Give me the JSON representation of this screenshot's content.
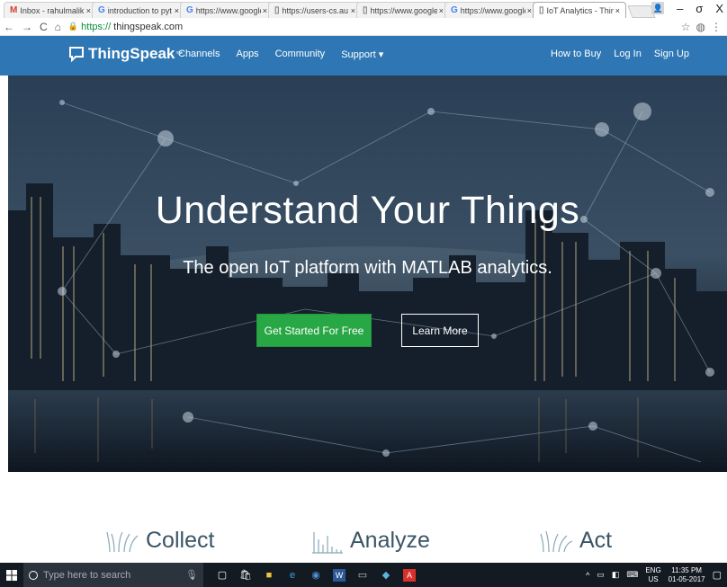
{
  "browser": {
    "tabs": [
      {
        "favicon": "M",
        "favicon_color": "#d23f31",
        "title": "Inbox - rahulmalikll",
        "active": false
      },
      {
        "favicon": "G",
        "favicon_color": "#4285f4",
        "title": "introduction to pyt",
        "active": false
      },
      {
        "favicon": "G",
        "favicon_color": "#4285f4",
        "title": "https://www.google",
        "active": false
      },
      {
        "favicon": "▯",
        "favicon_color": "#777777",
        "title": "https://users-cs.au",
        "active": false
      },
      {
        "favicon": "▯",
        "favicon_color": "#777777",
        "title": "https://www.google",
        "active": false
      },
      {
        "favicon": "G",
        "favicon_color": "#4285f4",
        "title": "https://www.google",
        "active": false
      },
      {
        "favicon": "▯",
        "favicon_color": "#777777",
        "title": "IoT Analytics - Thin",
        "active": true
      }
    ],
    "window_controls": {
      "minimize": "–",
      "maximize": "σ",
      "close": "X"
    },
    "address": {
      "protocol": "https://",
      "host": "thingspeak.com"
    }
  },
  "site": {
    "logo_text": "ThingSpeak",
    "logo_tm": "™",
    "nav_left": [
      "Channels",
      "Apps",
      "Community",
      "Support ▾"
    ],
    "nav_right": [
      "How to Buy",
      "Log In",
      "Sign Up"
    ],
    "brand_color": "#2f77b4"
  },
  "hero": {
    "title": "Understand Your Things",
    "subtitle": "The open IoT platform with MATLAB analytics.",
    "primary_button": "Get Started For Free",
    "secondary_button": "Learn More",
    "primary_color": "#28a745"
  },
  "features": [
    {
      "icon": "collect-icon",
      "label": "Collect"
    },
    {
      "icon": "analyze-icon",
      "label": "Analyze"
    },
    {
      "icon": "act-icon",
      "label": "Act"
    }
  ],
  "taskbar": {
    "search_placeholder": "Type here to search",
    "language": "ENG",
    "region": "US",
    "time": "11:35 PM",
    "date": "01-05-2017"
  }
}
